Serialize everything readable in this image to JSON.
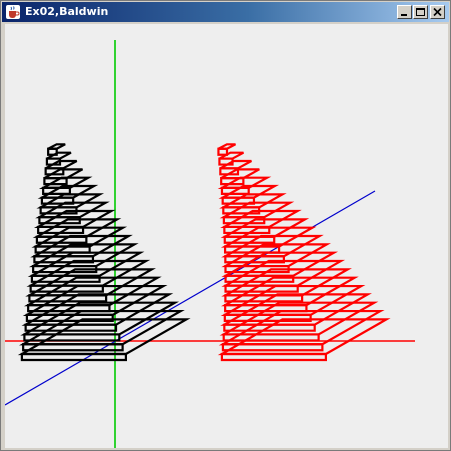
{
  "window": {
    "title": "Ex02,Baldwin",
    "icon": "java-cup-icon",
    "controls": [
      "minimize-icon",
      "maximize-icon",
      "close-icon"
    ]
  },
  "scene": {
    "axes": {
      "x_color": "#ff0000",
      "y_color": "#00cc00",
      "z_color": "#0000cc"
    },
    "left_pyramid": {
      "color": "#000000",
      "layers": 22
    },
    "right_pyramid": {
      "color": "#ff0000",
      "layers": 22,
      "twist": "sheared"
    }
  }
}
